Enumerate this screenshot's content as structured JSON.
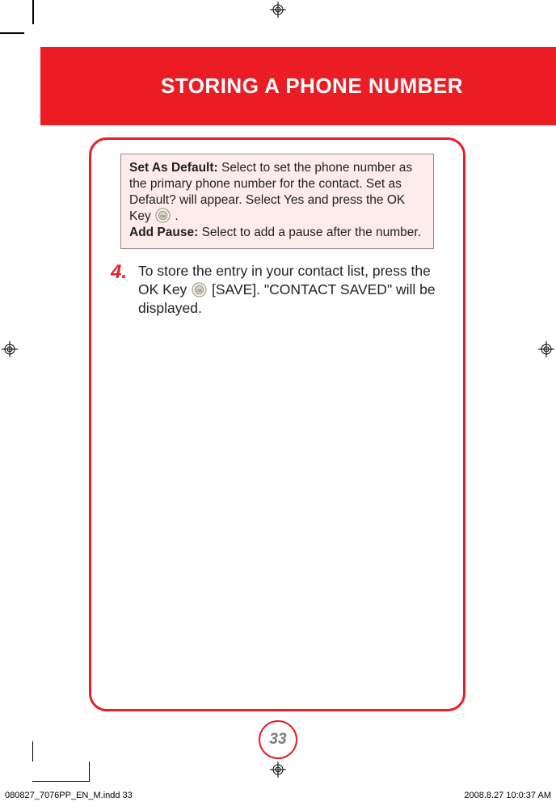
{
  "header": {
    "title": "STORING A PHONE NUMBER"
  },
  "tip": {
    "set_default_label": "Set As Default:",
    "set_default_text_1": " Select to set the phone number as the primary phone number for the contact. Set as Default? will appear. Select Yes and press the OK Key ",
    "set_default_text_2": " .",
    "add_pause_label": "Add Pause:",
    "add_pause_text": " Select to add a pause after the number."
  },
  "step4": {
    "number": "4.",
    "text_1": "To store the entry in your contact list, press the OK Key ",
    "text_2": " [SAVE]. \"CONTACT SAVED\" will be displayed."
  },
  "page_number": "33",
  "slug": {
    "file": "080827_7076PP_EN_M.indd   33",
    "timestamp": "2008.8.27   10:0:37 AM"
  }
}
